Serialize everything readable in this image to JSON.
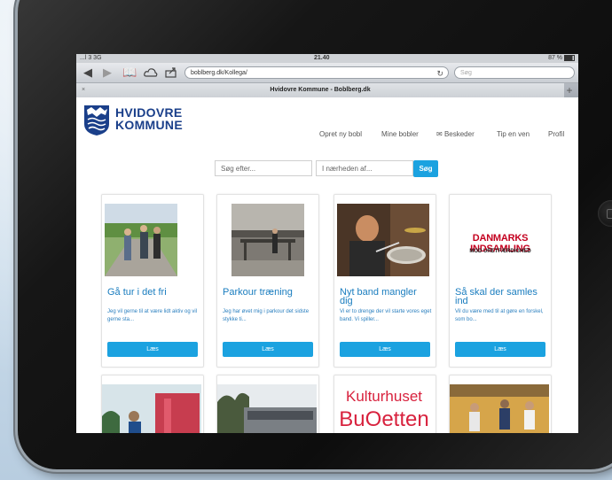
{
  "status": {
    "left": "...l 3 3G",
    "time": "21.40",
    "battery": "87 %"
  },
  "browser": {
    "url": "boblberg.dk/Kollega/",
    "search_placeholder": "Søg",
    "tab_title": "Hvidovre Kommune - Boblberg.dk",
    "icons": [
      "back-arrow-icon",
      "forward-arrow-icon",
      "bookmarks-icon",
      "cloud-icon",
      "share-icon",
      "reload-icon",
      "close-tab-icon",
      "new-tab-icon"
    ]
  },
  "site": {
    "brand_line1": "HVIDOVRE",
    "brand_line2": "KOMMUNE",
    "nav": [
      "Opret ny bobl",
      "Mine bobler",
      "Beskeder",
      "Tip en ven",
      "Profil"
    ],
    "search_what_placeholder": "Søg efter...",
    "search_near_placeholder": "I nærheden af...",
    "search_button": "Søg",
    "brand_color": "#1a3f8a",
    "accent_color": "#1ba2e0"
  },
  "cards": [
    {
      "title": "Gå tur i det fri",
      "desc": "Jeg vil gerne til at være lidt aktiv og vil gerne sta...",
      "button": "Læs",
      "image": "people walking outdoors photo"
    },
    {
      "title": "Parkour træning",
      "desc": "Jeg har øvet mig i parkour det sidste stykke ti...",
      "button": "Læs",
      "image": "indoor parkour hall photo"
    },
    {
      "title": "Nyt band mangler dig",
      "desc": "Vi er to drenge der vil starte vores eget band. Vi spiller...",
      "button": "Læs",
      "image": "drummer photo"
    },
    {
      "title": "Så skal der samles ind",
      "desc": "Vil du være med til at gøre en forskel, som bo...",
      "button": "Læs",
      "image": "DANMARKS INDSAMLING",
      "image_sub": "MOD URETFÆRDIGHED"
    }
  ],
  "row2": [
    {
      "image": "outdoor festival photo"
    },
    {
      "image": "building photo"
    },
    {
      "image": "Kulturhuset BibOetten",
      "logo_line1": "Kulturhuset",
      "logo_line2": "BuOetten"
    },
    {
      "image": "indoor sports photo"
    }
  ]
}
